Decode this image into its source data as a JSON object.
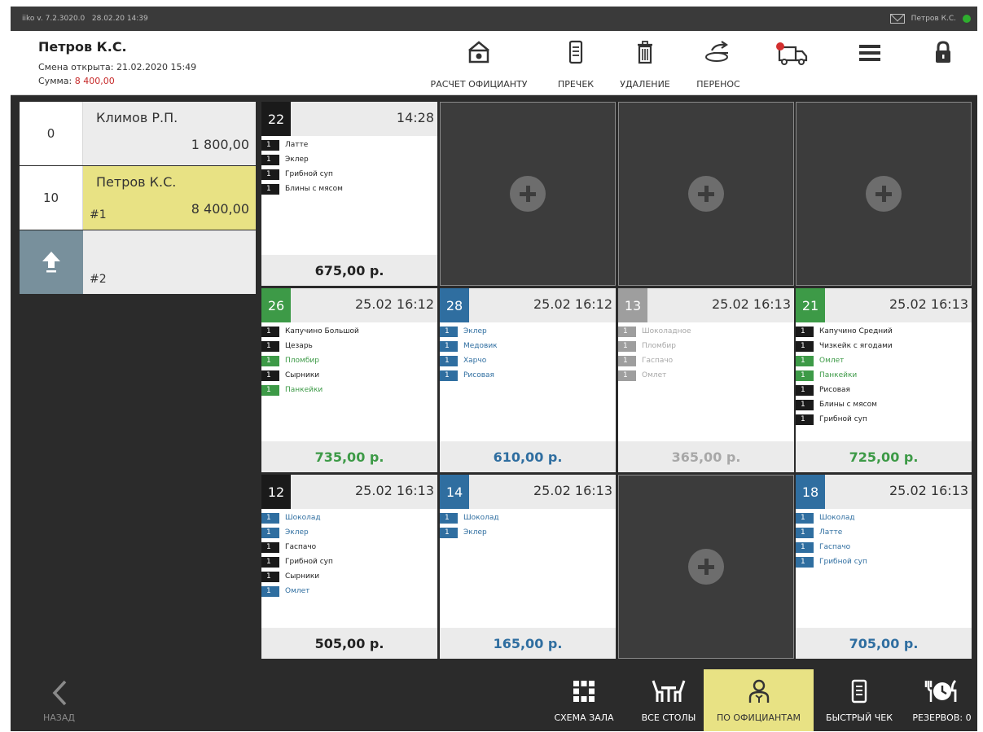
{
  "status": {
    "version": "iiko  v. 7.2.3020.0",
    "datetime": "28.02.20  14:39",
    "user": "Петров К.С."
  },
  "header": {
    "name": "Петров К.С.",
    "shift": "Смена открыта: 21.02.2020 15:49",
    "sum_label": "Сумма: ",
    "sum_value": "8 400,00"
  },
  "toolbar": {
    "waiter_payment": "РАСЧЕТ ОФИЦИАНТУ",
    "precheck": "ПРЕЧЕК",
    "delete": "УДАЛЕНИЕ",
    "transfer": "ПЕРЕНОС"
  },
  "waiters": [
    {
      "count": "0",
      "name": "Климов Р.П.",
      "sum": "1 800,00"
    },
    {
      "count": "10",
      "name": "Петров К.С.",
      "num": "#1",
      "sum": "8 400,00"
    },
    {
      "num": "#2"
    }
  ],
  "orders": {
    "o22": {
      "num": "22",
      "time": "14:28",
      "total": "675,00 р.",
      "items": [
        {
          "q": "1",
          "name": "Латте"
        },
        {
          "q": "1",
          "name": "Эклер"
        },
        {
          "q": "1",
          "name": "Грибной суп"
        },
        {
          "q": "1",
          "name": "Блины с мясом"
        }
      ]
    },
    "o26": {
      "num": "26",
      "time": "25.02 16:12",
      "total": "735,00 р.",
      "items": [
        {
          "q": "1",
          "name": "Капучино Большой"
        },
        {
          "q": "1",
          "name": "Цезарь"
        },
        {
          "q": "1",
          "name": "Пломбир"
        },
        {
          "q": "1",
          "name": "Сырники"
        },
        {
          "q": "1",
          "name": "Панкейки"
        }
      ]
    },
    "o28": {
      "num": "28",
      "time": "25.02 16:12",
      "total": "610,00 р.",
      "items": [
        {
          "q": "1",
          "name": "Эклер"
        },
        {
          "q": "1",
          "name": "Медовик"
        },
        {
          "q": "1",
          "name": "Харчо"
        },
        {
          "q": "1",
          "name": "Рисовая"
        }
      ]
    },
    "o13": {
      "num": "13",
      "time": "25.02 16:13",
      "total": "365,00 р.",
      "items": [
        {
          "q": "1",
          "name": "Шоколадное"
        },
        {
          "q": "1",
          "name": "Пломбир"
        },
        {
          "q": "1",
          "name": "Гаспачо"
        },
        {
          "q": "1",
          "name": "Омлет"
        }
      ]
    },
    "o21": {
      "num": "21",
      "time": "25.02 16:13",
      "total": "725,00 р.",
      "items": [
        {
          "q": "1",
          "name": "Капучино Средний"
        },
        {
          "q": "1",
          "name": "Чизкейк с ягодами"
        },
        {
          "q": "1",
          "name": "Омлет"
        },
        {
          "q": "1",
          "name": "Панкейки"
        },
        {
          "q": "1",
          "name": "Рисовая"
        },
        {
          "q": "1",
          "name": "Блины с мясом"
        },
        {
          "q": "1",
          "name": "Грибной суп"
        }
      ]
    },
    "o12": {
      "num": "12",
      "time": "25.02 16:13",
      "total": "505,00 р.",
      "items": [
        {
          "q": "1",
          "name": "Шоколад"
        },
        {
          "q": "1",
          "name": "Эклер"
        },
        {
          "q": "1",
          "name": "Гаспачо"
        },
        {
          "q": "1",
          "name": "Грибной суп"
        },
        {
          "q": "1",
          "name": "Сырники"
        },
        {
          "q": "1",
          "name": "Омлет"
        }
      ]
    },
    "o14": {
      "num": "14",
      "time": "25.02 16:13",
      "total": "165,00 р.",
      "items": [
        {
          "q": "1",
          "name": "Шоколад"
        },
        {
          "q": "1",
          "name": "Эклер"
        }
      ]
    },
    "o18": {
      "num": "18",
      "time": "25.02 16:13",
      "total": "705,00 р.",
      "items": [
        {
          "q": "1",
          "name": "Шоколад"
        },
        {
          "q": "1",
          "name": "Латте"
        },
        {
          "q": "1",
          "name": "Гаспачо"
        },
        {
          "q": "1",
          "name": "Грибной суп"
        }
      ]
    }
  },
  "bottom": {
    "back": "НАЗАД",
    "hall": "СХЕМА ЗАЛА",
    "all_tables": "ВСЕ СТОЛЫ",
    "by_waiters": "ПО ОФИЦИАНТАМ",
    "quick_check": "БЫСТРЫЙ ЧЕК",
    "reserves": "РЕЗЕРВОВ: 0"
  },
  "colors": {
    "accent": "#e8e284",
    "green": "#3d9a47",
    "blue": "#2f6ea0",
    "gray": "#9e9e9e",
    "alert": "#c62828"
  }
}
